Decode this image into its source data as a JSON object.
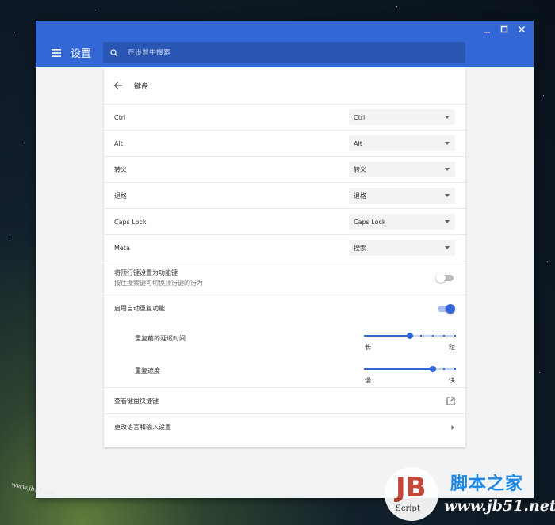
{
  "window": {
    "controls": [
      "minimize",
      "maximize",
      "close"
    ]
  },
  "appbar": {
    "title": "设置",
    "search_placeholder": "在设置中搜索"
  },
  "page": {
    "title": "键盘"
  },
  "key_mappings": [
    {
      "label": "Ctrl",
      "value": "Ctrl"
    },
    {
      "label": "Alt",
      "value": "Alt"
    },
    {
      "label": "转义",
      "value": "转义"
    },
    {
      "label": "退格",
      "value": "退格"
    },
    {
      "label": "Caps Lock",
      "value": "Caps Lock"
    },
    {
      "label": "Meta",
      "value": "搜索"
    }
  ],
  "top_row_keys": {
    "label": "将顶行键设置为功能键",
    "sublabel": "按住搜索键可切换顶行键的行为",
    "enabled": false
  },
  "auto_repeat": {
    "label": "启用自动重复功能",
    "enabled": true,
    "delay": {
      "label": "重复前的延迟时间",
      "min_label": "长",
      "max_label": "短",
      "value": 0.5
    },
    "rate": {
      "label": "重复速度",
      "min_label": "慢",
      "max_label": "快",
      "value": 0.75
    }
  },
  "links": {
    "shortcuts": "查看键盘快捷键",
    "language": "更改语言和输入设置"
  },
  "watermark": {
    "left_text": "www.jb51.net",
    "logo_text": "Script",
    "brand": "脚本之家",
    "brand_url": "www.jb51.net"
  },
  "colors": {
    "accent": "#3367d6",
    "toggle_on": "#3367d6",
    "toggle_off": "#bdbdbd"
  }
}
